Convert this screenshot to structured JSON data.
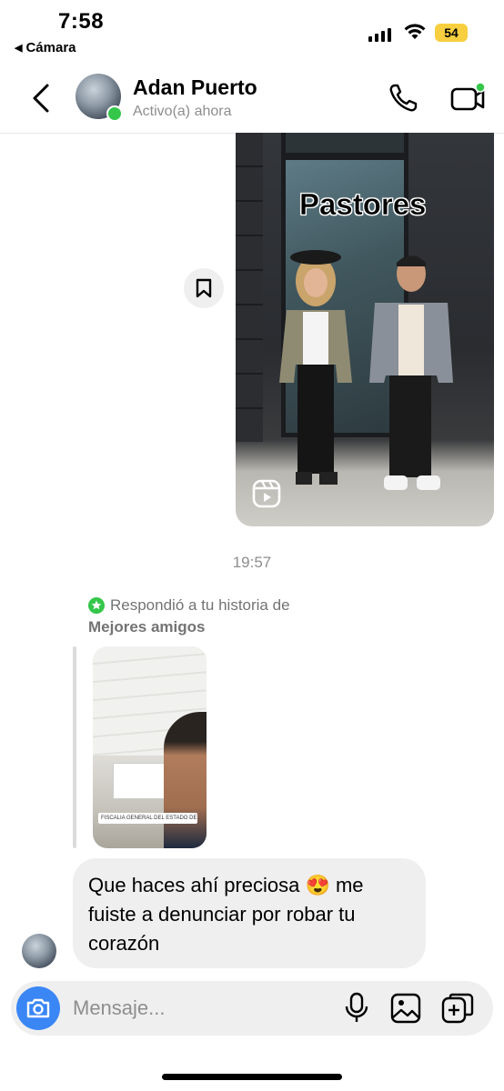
{
  "status_bar": {
    "time": "7:58",
    "back_app": "Cámara",
    "battery": "54"
  },
  "header": {
    "contact_name": "Adan Puerto",
    "contact_status": "Activo(a) ahora"
  },
  "reel": {
    "overlay_text": "Pastores"
  },
  "timestamp": "19:57",
  "story_reply": {
    "note": "Respondió a tu historia de",
    "note_list": "Mejores amigos",
    "banner_text": "FISCALIA GENERAL DEL ESTADO DE YUC..."
  },
  "message": {
    "text": "Que haces ahí preciosa 😍 me fuiste a denunciar por robar tu corazón"
  },
  "composer": {
    "placeholder": "Mensaje..."
  },
  "colors": {
    "accent": "#3a86f5",
    "online": "#34c74a",
    "bubble": "#efefef",
    "battery": "#f7cf3f"
  },
  "icons": [
    "back-arrow-icon",
    "phone-icon",
    "video-icon",
    "bookmark-icon",
    "reels-icon",
    "star-icon",
    "camera-icon",
    "microphone-icon",
    "gallery-icon",
    "sticker-icon"
  ]
}
